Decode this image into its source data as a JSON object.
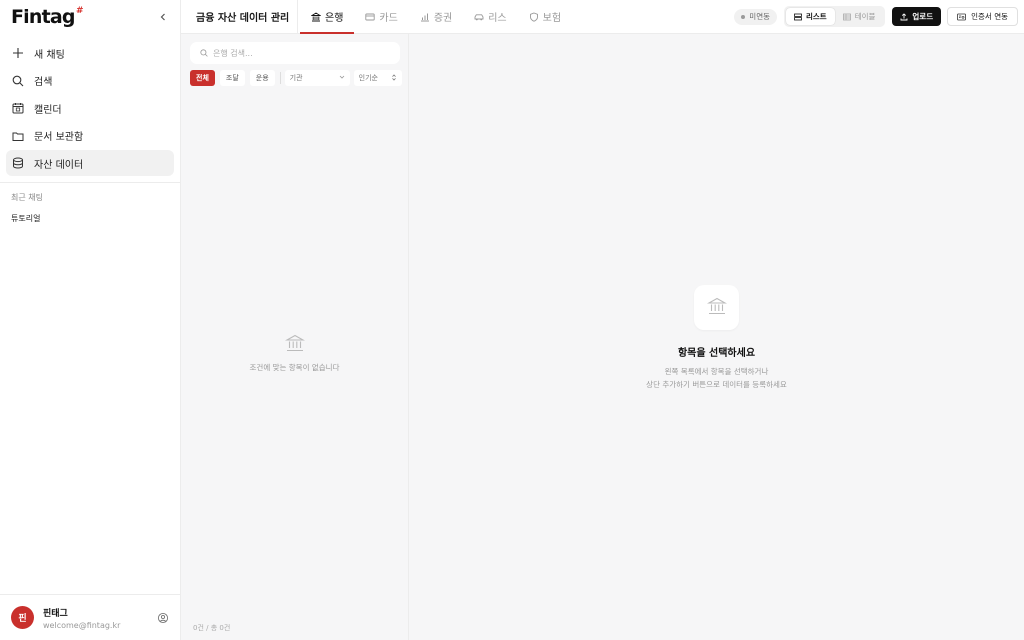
{
  "brand": {
    "name": "Fintag",
    "mark": "#"
  },
  "sidebar": {
    "items": [
      {
        "label": "새 채팅",
        "icon": "plus-icon"
      },
      {
        "label": "검색",
        "icon": "search-icon"
      },
      {
        "label": "캘린더",
        "icon": "calendar-icon"
      },
      {
        "label": "문서 보관함",
        "icon": "folder-icon"
      },
      {
        "label": "자산 데이터",
        "icon": "database-icon",
        "active": true
      }
    ],
    "recent_title": "최근 채팅",
    "recent": [
      "튜토리얼"
    ],
    "user": {
      "initial": "핀",
      "name": "핀태그",
      "email": "welcome@fintag.kr"
    }
  },
  "header": {
    "title": "금융 자산 데이터 관리",
    "tabs": [
      {
        "label": "은행",
        "icon": "bank-icon",
        "active": true
      },
      {
        "label": "카드",
        "icon": "card-icon"
      },
      {
        "label": "증권",
        "icon": "chart-icon"
      },
      {
        "label": "리스",
        "icon": "car-icon"
      },
      {
        "label": "보험",
        "icon": "shield-icon"
      }
    ],
    "status": "미연동",
    "view_list": "리스트",
    "view_table": "테이블",
    "upload": "업로드",
    "cert": "인증서 연동"
  },
  "list": {
    "search_placeholder": "은행 검색...",
    "chips": [
      "전체",
      "조달",
      "운용"
    ],
    "institution_select": "기관",
    "sort_select": "인기순",
    "empty": "조건에 맞는 항목이 없습니다",
    "footer": "0건 / 총 0건"
  },
  "detail": {
    "title": "항목을 선택하세요",
    "line1": "왼쪽 목록에서 항목을 선택하거나",
    "line2": "상단 추가하기 버튼으로 데이터를 등록하세요"
  },
  "colors": {
    "accent": "#c9302c",
    "dark": "#111111"
  }
}
